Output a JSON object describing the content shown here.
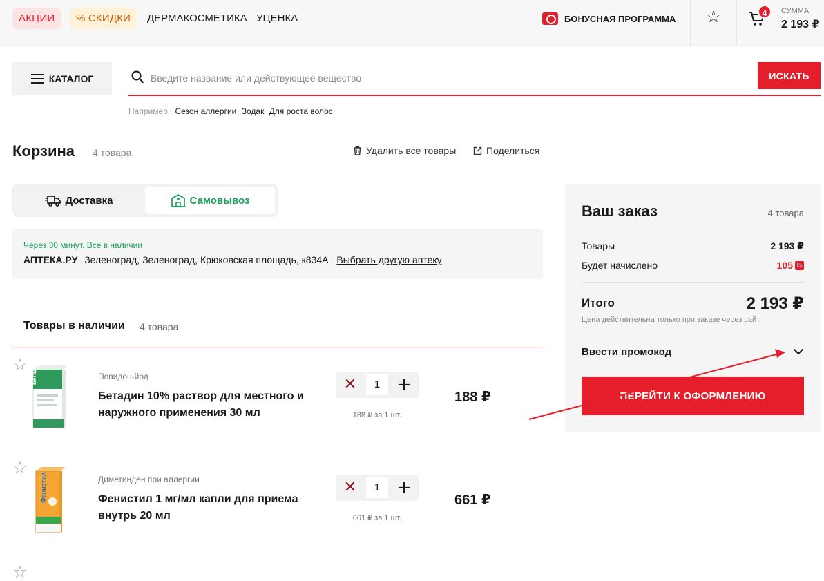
{
  "header": {
    "nav": [
      "АКЦИИ",
      "% СКИДКИ",
      "ДЕРМАКОСМЕТИКА",
      "УЦЕНКА"
    ],
    "bonus_program": "БОНУСНАЯ ПРОГРАММА",
    "cart_badge": "4",
    "sum_label": "СУММА",
    "sum_value": "2 193 ₽"
  },
  "search": {
    "catalog_label": "КАТАЛОГ",
    "placeholder": "Введите название или действующее вещество",
    "value": "",
    "button_label": "ИСКАТЬ",
    "examples_label": "Например:",
    "examples": [
      "Сезон аллергии",
      "Зодак",
      "Для роста волос"
    ]
  },
  "cart": {
    "title": "Корзина",
    "count": "4 товара",
    "delete_all": "Удалить все товары",
    "share": "Поделиться"
  },
  "delivery_tabs": {
    "delivery": "Доставка",
    "pickup": "Самовывоз",
    "active": "pickup"
  },
  "pharmacy": {
    "note": "Через 30 минут. Все в наличии",
    "name": "АПТЕКА.РУ",
    "address": "Зеленоград, Зеленоград, Крюковская площадь, к834А",
    "change_link": "Выбрать другую аптеку"
  },
  "in_stock": {
    "title": "Товары в наличии",
    "count": "4 товара"
  },
  "products": [
    {
      "category": "Повидон-йод",
      "name": "Бетадин 10% раствор для местного и наружного применения 30 мл",
      "qty": "1",
      "unit_price": "188 ₽ за 1 шт.",
      "price": "188 ₽",
      "box_label": "Бетадин"
    },
    {
      "category": "Диметинден при аллергии",
      "name": "Фенистил 1 мг/мл капли для приема внутрь 20 мл",
      "qty": "1",
      "unit_price": "661 ₽ за 1 шт.",
      "price": "661 ₽",
      "box_label": "Фенистил"
    }
  ],
  "summary": {
    "title": "Ваш заказ",
    "count": "4 товара",
    "goods_label": "Товары",
    "goods_value": "2 193 ₽",
    "bonus_label": "Будет начислено",
    "bonus_value": "105",
    "bonus_icon_letter": "Б",
    "total_label": "Итого",
    "total_value": "2 193 ₽",
    "note": "Цена действительна только при заказе через сайт.",
    "promo_label": "Ввести промокод",
    "checkout_label": "ПЕРЕЙТИ К ОФОРМЛЕНИЮ"
  },
  "colors": {
    "brand_red": "#e41e2a",
    "green": "#17a05a",
    "panel": "#f5f5f5"
  }
}
